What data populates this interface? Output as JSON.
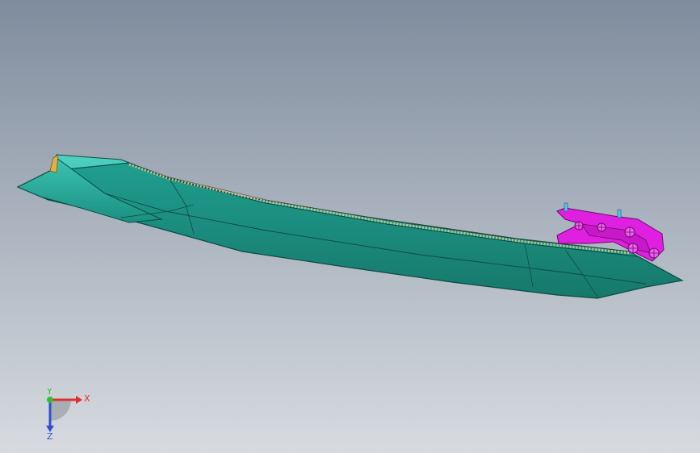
{
  "viewport": {
    "background_top": "#7f8c9d",
    "background_bottom": "#d7dbe0"
  },
  "model": {
    "body_color": "#1f9e8e",
    "body_edge_color": "#0c4a44",
    "bracket_color": "#e020e0",
    "pin_color": "#5bc0ea",
    "endcap_color": "#e0b040"
  },
  "triad": {
    "x_label": "X",
    "y_label": "Y",
    "z_label": "Z",
    "x_color": "#e03030",
    "y_color": "#30c030",
    "z_color": "#3050d0"
  }
}
